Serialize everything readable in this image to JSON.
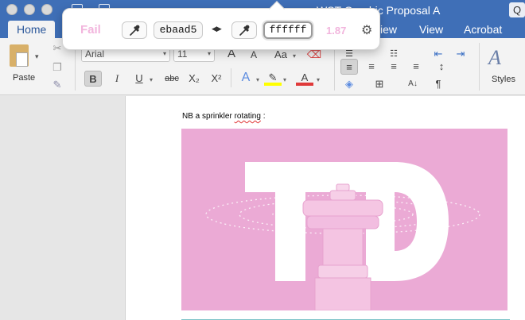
{
  "window": {
    "title": "WST Graphic Proposal A",
    "help_label": "Q"
  },
  "tabs": [
    {
      "label": "Home",
      "active": true
    },
    {
      "label": "iew"
    },
    {
      "label": "View"
    },
    {
      "label": "Acrobat"
    }
  ],
  "ribbon": {
    "paste_label": "Paste",
    "font_name": "Arial",
    "font_size": "11",
    "grow_font": "A",
    "shrink_font": "A",
    "change_case": "Aa",
    "bold": "B",
    "italic": "I",
    "underline": "U",
    "strikethrough": "abc",
    "subscript": "X₂",
    "superscript": "X²",
    "text_effects": "A",
    "font_color": "A",
    "paragraph_mark": "¶",
    "styles_label": "Styles",
    "font_color_swatch": "#e03a3a",
    "highlight_swatch": "#ffff00"
  },
  "checker": {
    "status": "Fail",
    "foreground_hex": "ebaad5",
    "background_hex": "ffffff",
    "ratio": "1.87",
    "status_color": "#f2b5dd"
  },
  "document": {
    "caption_prefix": "NB a sprinkler ",
    "caption_misspelled": "rotating",
    "caption_suffix": " :",
    "image_bg_color": "#ebaad5",
    "image_letters": "TD"
  }
}
